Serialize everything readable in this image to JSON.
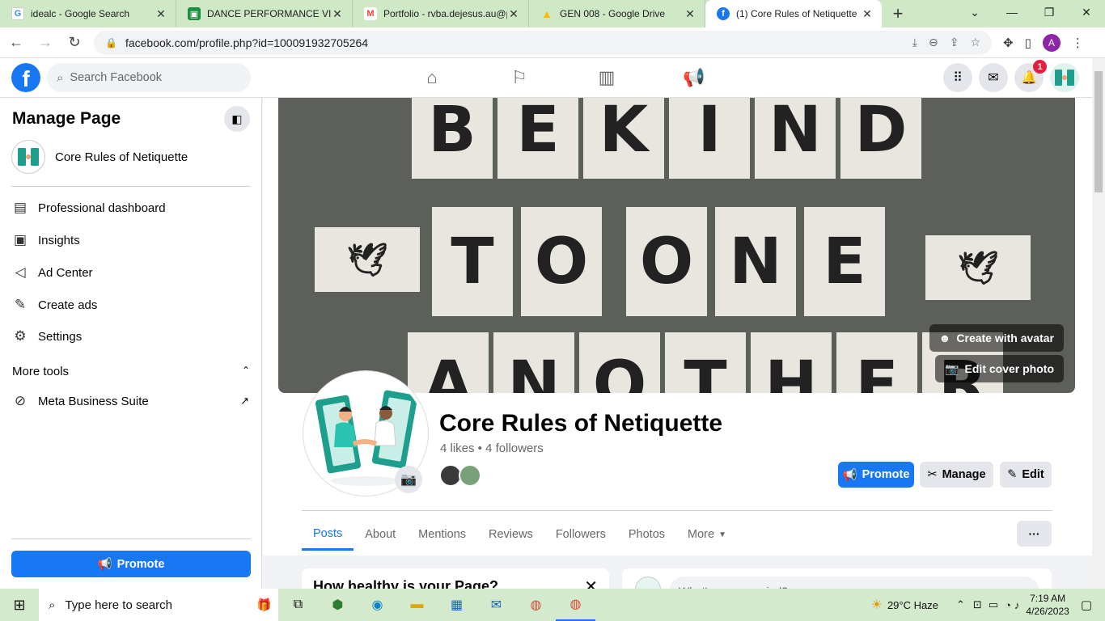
{
  "browser": {
    "tabs": [
      {
        "title": "idealc - Google Search",
        "icon": "google-icon",
        "color": "#4285f4"
      },
      {
        "title": "DANCE PERFORMANCE VIDE",
        "icon": "classroom-icon",
        "color": "#1e8e3e"
      },
      {
        "title": "Portfolio - rvba.dejesus.au@p",
        "icon": "gmail-icon",
        "color": "#ea4335"
      },
      {
        "title": "GEN 008 - Google Drive",
        "icon": "drive-icon",
        "color": "#fbbc04"
      },
      {
        "title": "(1) Core Rules of Netiquette",
        "icon": "facebook-icon",
        "color": "#1877f2"
      }
    ],
    "url": "facebook.com/profile.php?id=100091932705264",
    "profile_initial": "A"
  },
  "facebook": {
    "search_placeholder": "Search Facebook",
    "notification_count": "1"
  },
  "sidebar": {
    "title": "Manage Page",
    "page_name": "Core Rules of Netiquette",
    "items": [
      {
        "label": "Professional dashboard",
        "icon": "dashboard-icon"
      },
      {
        "label": "Insights",
        "icon": "insights-icon"
      },
      {
        "label": "Ad Center",
        "icon": "megaphone-icon"
      },
      {
        "label": "Create ads",
        "icon": "pencil-icon"
      },
      {
        "label": "Settings",
        "icon": "gear-icon"
      }
    ],
    "more_tools_label": "More tools",
    "meta_suite_label": "Meta Business Suite",
    "promote_label": "Promote"
  },
  "cover": {
    "row1": [
      "B",
      "E",
      "K",
      "I",
      "N",
      "D"
    ],
    "row2": [
      "T",
      "O",
      "O",
      "N",
      "E"
    ],
    "row3": [
      "A",
      "N",
      "O",
      "T",
      "H",
      "E",
      "R"
    ],
    "create_avatar_label": "Create with avatar",
    "edit_cover_label": "Edit cover photo"
  },
  "profile": {
    "name": "Core Rules of Netiquette",
    "stats": "4 likes • 4 followers",
    "promote_label": "Promote",
    "manage_label": "Manage",
    "edit_label": "Edit"
  },
  "page_tabs": [
    "Posts",
    "About",
    "Mentions",
    "Reviews",
    "Followers",
    "Photos",
    "More"
  ],
  "cards": {
    "health_title": "How healthy is your Page?",
    "composer_placeholder": "What's on your mind?"
  },
  "taskbar": {
    "search_placeholder": "Type here to search",
    "weather": "29°C  Haze",
    "time": "7:19 AM",
    "date": "4/26/2023"
  },
  "colors": {
    "fb_blue": "#1877f2",
    "tab_strip": "#cfe8c6",
    "taskbar": "#d4eacc"
  }
}
